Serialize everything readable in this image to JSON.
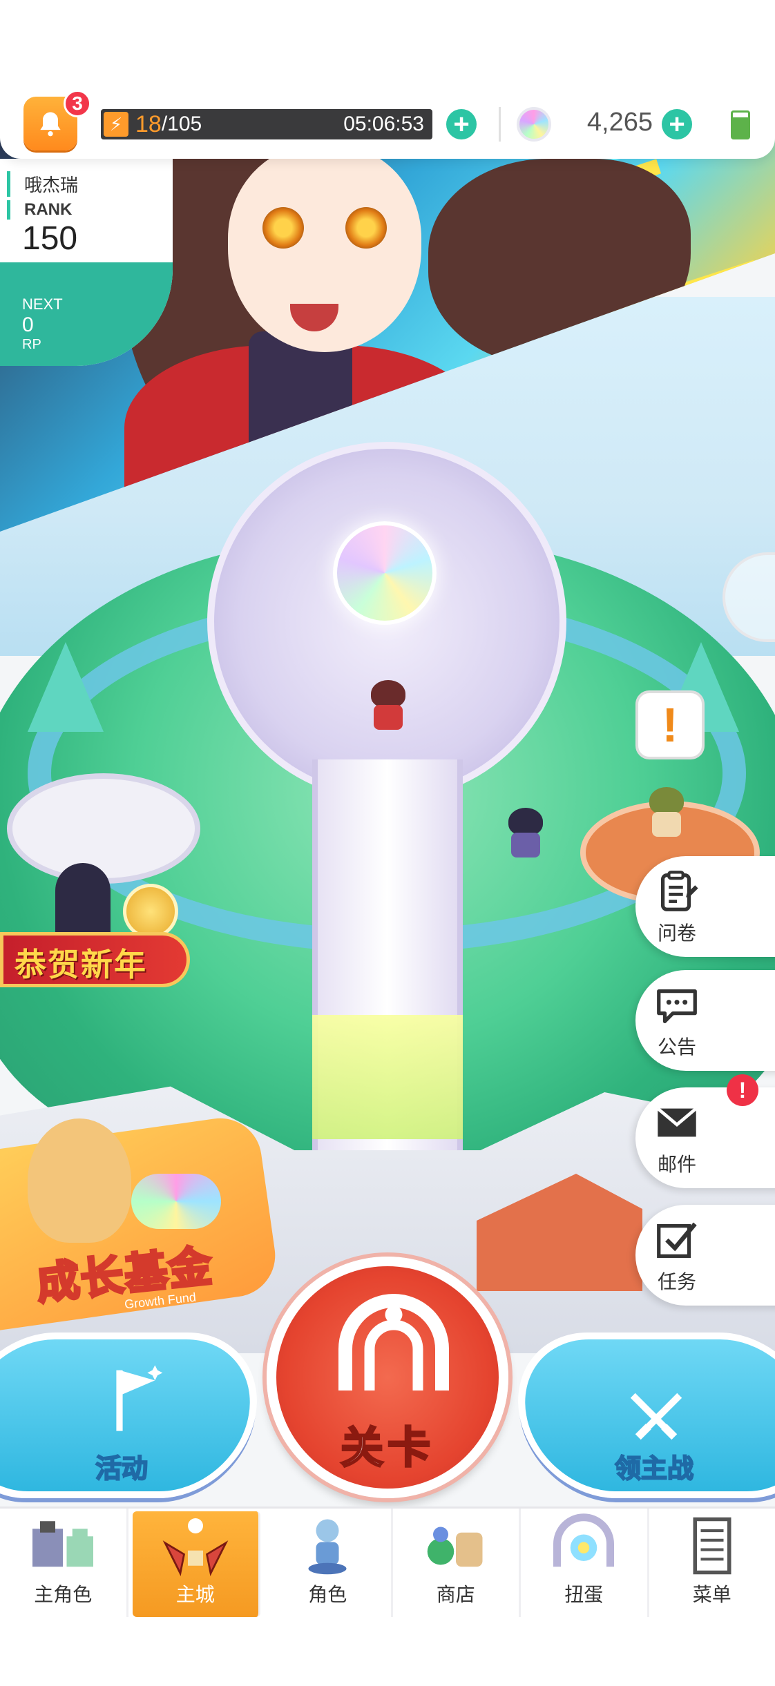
{
  "status": {
    "notification_count": "3",
    "stamina_current": "18",
    "stamina_max": "/105",
    "stamina_timer": "05:06:53",
    "gem_count": "4,265"
  },
  "player": {
    "name": "哦杰瑞",
    "rank_label": "RANK",
    "rank_value": "150",
    "next_label": "NEXT",
    "next_value": "0",
    "next_unit": "RP"
  },
  "side_menu": {
    "survey": "问卷",
    "notice": "公告",
    "mail": "邮件",
    "mail_badge": "!",
    "tasks": "任务"
  },
  "events": {
    "new_year": "恭贺新年",
    "growth_fund": "成长基金",
    "growth_fund_en": "Growth Fund"
  },
  "scene": {
    "npc_alert": "!"
  },
  "actions": {
    "activity": "活动",
    "stage": "关卡",
    "territory_battle": "领主战"
  },
  "nav": {
    "items": [
      {
        "label": "主角色"
      },
      {
        "label": "主城"
      },
      {
        "label": "角色"
      },
      {
        "label": "商店"
      },
      {
        "label": "扭蛋"
      },
      {
        "label": "菜单"
      }
    ],
    "active_index": 1
  },
  "colors": {
    "accent_orange": "#ff9b2b",
    "accent_teal": "#2cc5a4",
    "stage_red": "#e5442f",
    "action_blue": "#2fb7e0"
  }
}
